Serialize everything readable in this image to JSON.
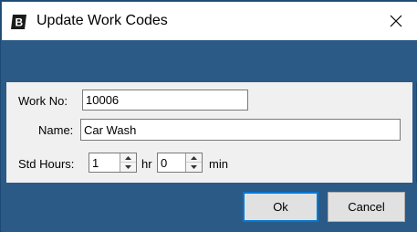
{
  "window": {
    "title": "Update Work Codes"
  },
  "icons": {
    "app": "app-logo-icon",
    "close": "close-icon",
    "up": "spin-up-icon",
    "down": "spin-down-icon"
  },
  "colors": {
    "frame": "#2b5a86",
    "form": "#f0f0f0",
    "default_border": "#0078d7"
  },
  "form": {
    "work_no": {
      "label": "Work No:",
      "value": "10006"
    },
    "name": {
      "label": "Name:",
      "value": "Car Wash"
    },
    "std_hours": {
      "label": "Std Hours:",
      "hours": "1",
      "hr_unit": "hr",
      "minutes": "0",
      "min_unit": "min"
    }
  },
  "buttons": {
    "ok": "Ok",
    "cancel": "Cancel"
  }
}
